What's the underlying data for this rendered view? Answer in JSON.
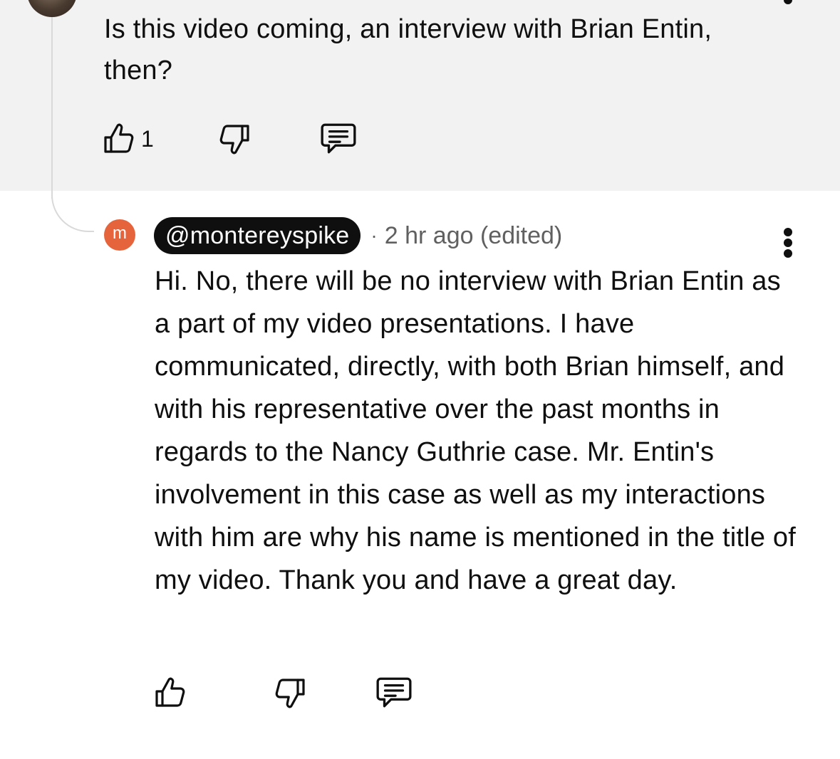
{
  "parent_comment": {
    "text": "Is this video coming, an interview with Brian Entin, then?",
    "like_count": "1",
    "icons": {
      "like": "thumbs-up-icon",
      "dislike": "thumbs-down-icon",
      "reply": "reply-comment-icon",
      "more": "more-vertical-icon"
    }
  },
  "reply": {
    "avatar_letter": "m",
    "avatar_color": "#e5643c",
    "handle": "@montereyspike",
    "separator": "·",
    "time": "2 hr ago (edited)",
    "text": "Hi. No, there will be no interview with Brian Entin as a part of my video presentations. I have communicated, directly, with both Brian himself, and with his representative over the past months in regards to the Nancy Guthrie case. Mr. Entin's involvement in this case as well as my interactions with him are why his name is mentioned in the title of my video. Thank you and have a great day.",
    "icons": {
      "like": "thumbs-up-icon",
      "dislike": "thumbs-down-icon",
      "reply": "reply-comment-icon",
      "more": "more-vertical-icon"
    }
  },
  "colors": {
    "highlight_background": "#f2f2f2",
    "text": "#0f0f0f",
    "meta": "#606060"
  }
}
